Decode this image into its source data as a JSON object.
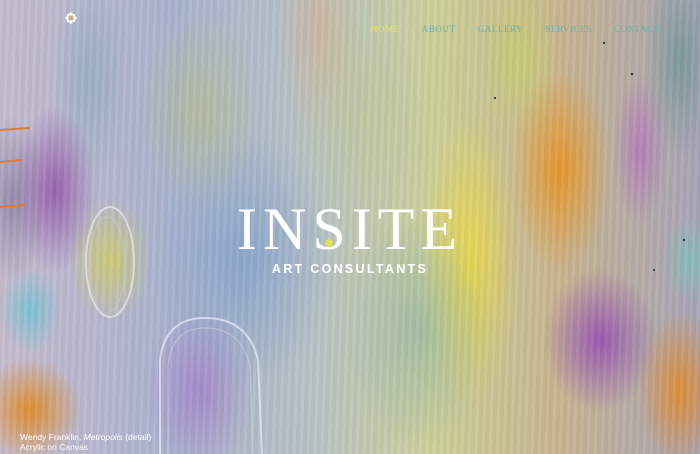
{
  "nav": {
    "items": [
      {
        "label": "HOME",
        "active": true
      },
      {
        "label": "ABOUT",
        "active": false
      },
      {
        "label": "GALLERY",
        "active": false
      },
      {
        "label": "SERVICES",
        "active": false
      },
      {
        "label": "CONTACT",
        "active": false
      }
    ]
  },
  "logo": {
    "word_part1": "IN",
    "word_part2": "SITE",
    "subtitle": "ART CONSULTANTS"
  },
  "caption": {
    "artist": "Wendy Franklin, ",
    "artwork_title": "Metropolis",
    "detail": " (detail)",
    "medium": "Acrylic on Canvas"
  },
  "colors": {
    "nav_active": "#e6e455",
    "nav_inactive": "#67b3b0",
    "logo_dot": "#e3de57"
  },
  "icons": {
    "brand_mark": "flower-icon"
  }
}
